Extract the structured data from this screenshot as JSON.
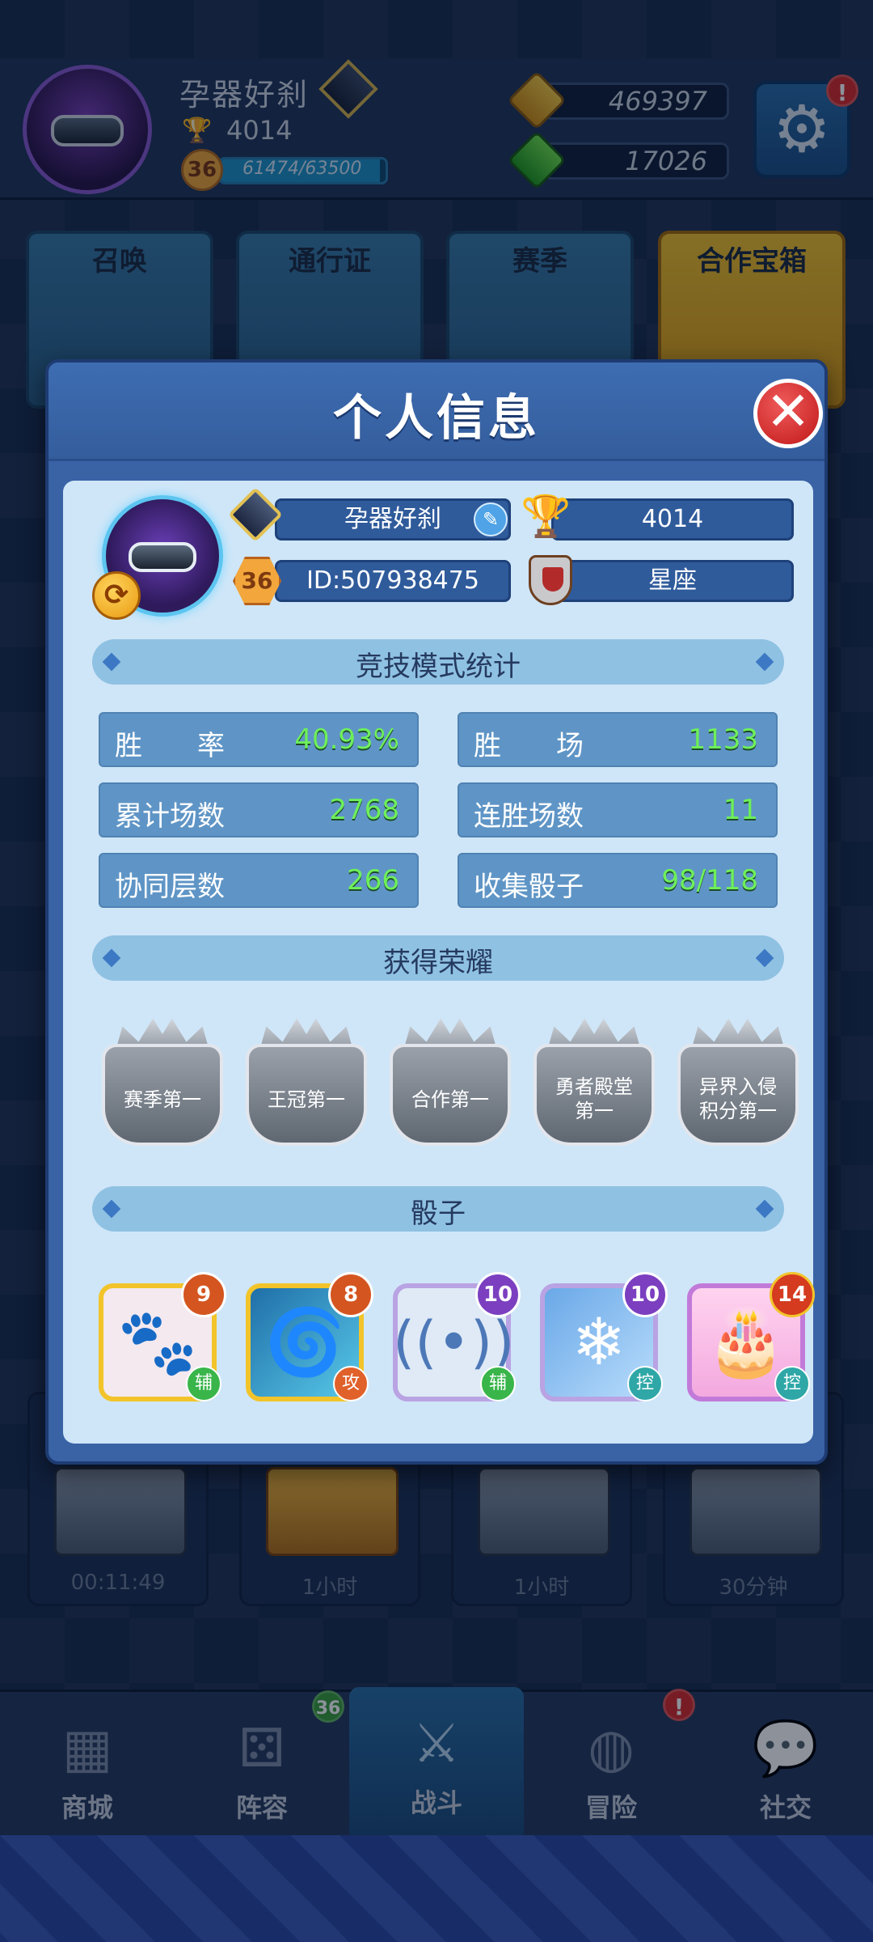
{
  "topbar": {
    "player_name": "孕器好刹",
    "trophies": "4014",
    "level": "36",
    "xp": "61474/63500",
    "xp_fraction": 0.968,
    "gold": "469397",
    "gems": "17026",
    "alert": "!"
  },
  "menu": [
    {
      "label": "召唤"
    },
    {
      "label": "通行证"
    },
    {
      "label": "赛季"
    },
    {
      "label": "合作宝箱"
    }
  ],
  "chests": [
    {
      "timer": "00:11:49"
    },
    {
      "timer": "1小时"
    },
    {
      "timer": "1小时"
    },
    {
      "timer": "30分钟"
    }
  ],
  "nav": [
    {
      "label": "商城"
    },
    {
      "label": "阵容",
      "badge": "36"
    },
    {
      "label": "战斗"
    },
    {
      "label": "冒险",
      "badge": "!"
    },
    {
      "label": "社交"
    }
  ],
  "modal": {
    "title": "个人信息",
    "profile": {
      "name": "孕器好刹",
      "trophies": "4014",
      "level": "36",
      "id": "ID:507938475",
      "clan": "星座"
    },
    "stats_title": "竞技模式统计",
    "stats": [
      {
        "label": "胜　　率",
        "value": "40.93%"
      },
      {
        "label": "胜　　场",
        "value": "1133"
      },
      {
        "label": "累计场数",
        "value": "2768"
      },
      {
        "label": "连胜场数",
        "value": "11"
      },
      {
        "label": "协同层数",
        "value": "266"
      },
      {
        "label": "收集骰子",
        "value": "98/118"
      }
    ],
    "honors_title": "获得荣耀",
    "honors": [
      {
        "line1": "赛季第一",
        "line2": ""
      },
      {
        "line1": "王冠第一",
        "line2": ""
      },
      {
        "line1": "合作第一",
        "line2": ""
      },
      {
        "line1": "勇者殿堂",
        "line2": "第一"
      },
      {
        "line1": "异界入侵",
        "line2": "积分第一"
      }
    ],
    "dice_title": "骰子",
    "dice": [
      {
        "level": "9",
        "type": "辅",
        "icon": "paw-icon"
      },
      {
        "level": "8",
        "type": "攻",
        "icon": "vortex-icon"
      },
      {
        "level": "10",
        "type": "辅",
        "icon": "signal-icon"
      },
      {
        "level": "10",
        "type": "控",
        "icon": "snowflake-icon"
      },
      {
        "level": "14",
        "type": "控",
        "icon": "cake-icon"
      }
    ]
  }
}
